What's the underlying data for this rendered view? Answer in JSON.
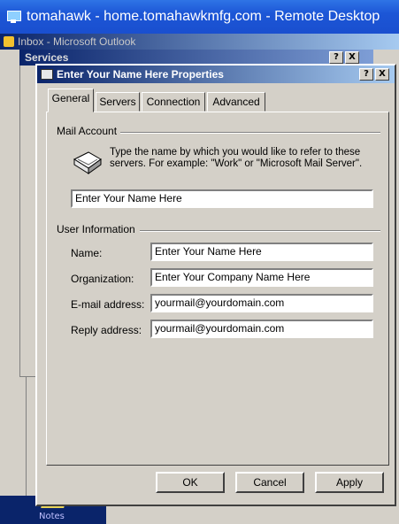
{
  "remote_desktop": {
    "title": "tomahawk - home.tomahawkmfg.com - Remote Desktop"
  },
  "outlook": {
    "title": "Inbox - Microsoft Outlook",
    "notes_label": "Notes"
  },
  "services_window": {
    "title": "Services",
    "help_label": "?",
    "close_label": "X"
  },
  "dialog": {
    "title": "Enter Your Name Here Properties",
    "help_label": "?",
    "close_label": "X",
    "tabs": [
      {
        "label": "General"
      },
      {
        "label": "Servers"
      },
      {
        "label": "Connection"
      },
      {
        "label": "Advanced"
      }
    ],
    "mail_account": {
      "group_label": "Mail Account",
      "description": "Type the name by which you would like to refer to these servers.  For example: \"Work\" or \"Microsoft Mail Server\".",
      "account_name": "Enter Your Name Here"
    },
    "user_info": {
      "group_label": "User Information",
      "name_label": "Name:",
      "name_value": "Enter Your Name Here",
      "org_label": "Organization:",
      "org_value": "Enter Your Company Name Here",
      "email_label": "E-mail address:",
      "email_value": "yourmail@yourdomain.com",
      "reply_label": "Reply address:",
      "reply_value": "yourmail@yourdomain.com"
    },
    "buttons": {
      "ok": "OK",
      "cancel": "Cancel",
      "apply": "Apply"
    }
  }
}
